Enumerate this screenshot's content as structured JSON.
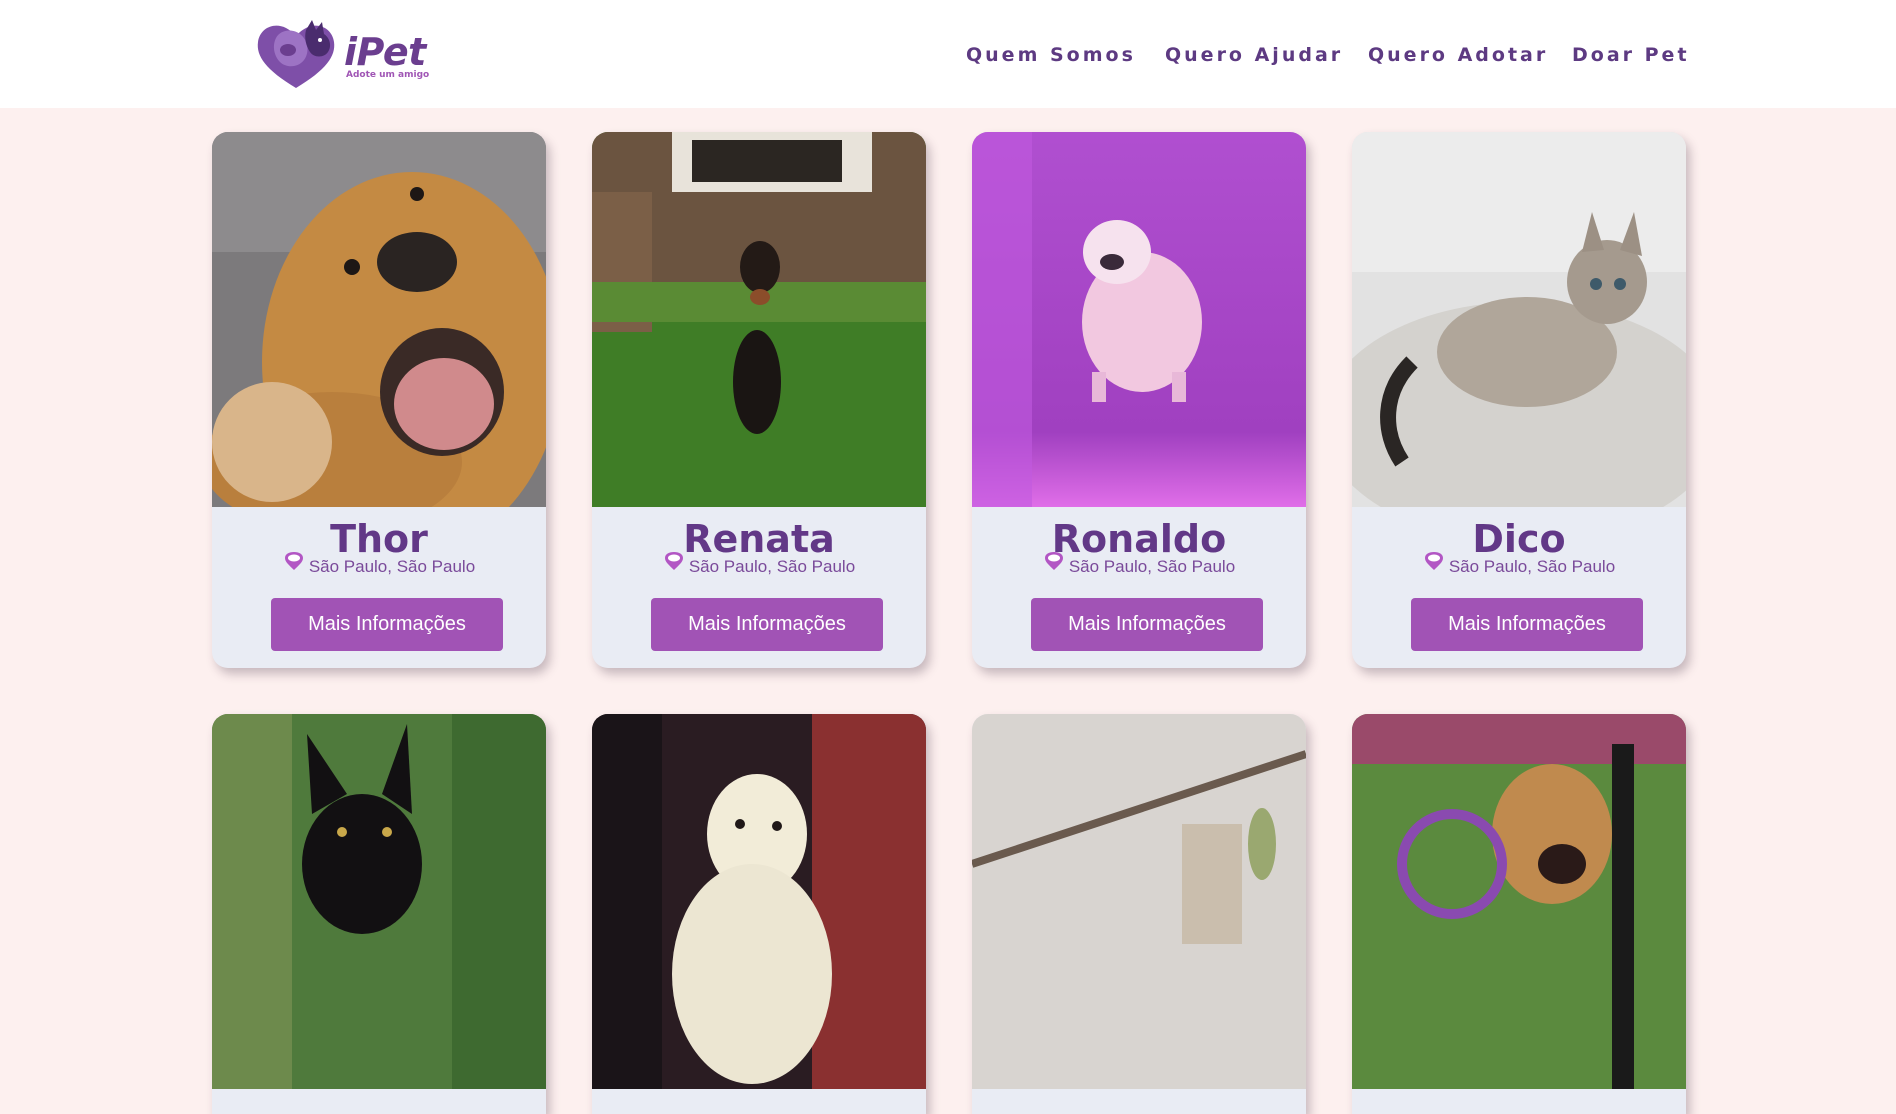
{
  "brand": {
    "name": "iPet",
    "tagline": "Adote um amigo"
  },
  "nav": [
    "Quem Somos",
    "Quero Ajudar",
    "Quero Adotar",
    "Doar Pet"
  ],
  "pets": [
    {
      "name": "Thor",
      "location": "São Paulo, São Paulo",
      "button": "Mais Informações",
      "photo": "golden-retriever-photo"
    },
    {
      "name": "Renata",
      "location": "São Paulo, São Paulo",
      "button": "Mais Informações",
      "photo": "dachshund-running-photo"
    },
    {
      "name": "Ronaldo",
      "location": "São Paulo, São Paulo",
      "button": "Mais Informações",
      "photo": "bulldog-jumping-photo"
    },
    {
      "name": "Dico",
      "location": "São Paulo, São Paulo",
      "button": "Mais Informações",
      "photo": "tabby-kitten-photo"
    }
  ],
  "second_row_photos": [
    "black-cat-photo",
    "ferret-photo",
    "bird-perch-photo",
    "dog-wheelchair-photo"
  ],
  "colors": {
    "brand_purple": "#623887",
    "button_purple": "#a153b5",
    "page_bg": "#fdf0ef",
    "card_bg": "#e9ecf4"
  }
}
